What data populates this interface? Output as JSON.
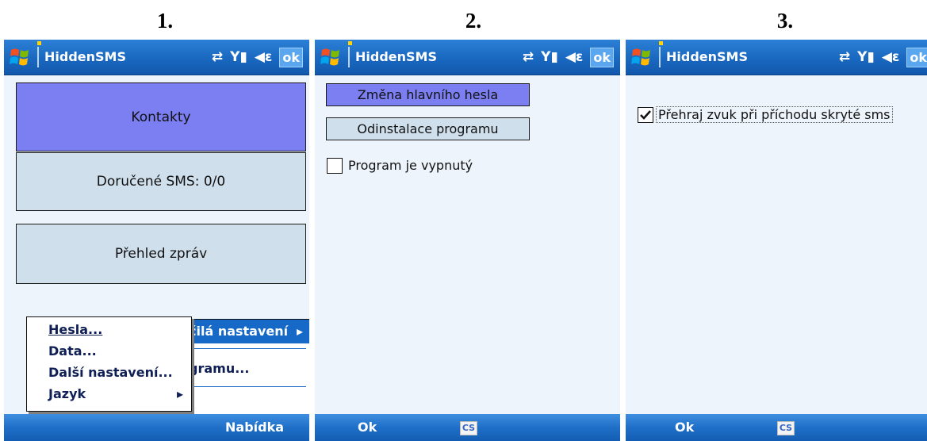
{
  "captions": [
    "1.",
    "2.",
    "3."
  ],
  "app": {
    "title": "HiddenSMS",
    "ok_label": "ok"
  },
  "screen1": {
    "buttons": [
      "Kontakty",
      "Doručené SMS: 0/0",
      "Přehled zpráv"
    ],
    "main_menu": {
      "item_advanced": "čilá nastavení",
      "item_program": "gramu..."
    },
    "submenu": [
      "Hesla...",
      "Data...",
      "Další nastavení...",
      "Jazyk"
    ],
    "softkey_right": "Nabídka"
  },
  "screen2": {
    "buttons": [
      "Změna hlavního hesla",
      "Odinstalace programu"
    ],
    "checkbox": {
      "label": "Program je vypnutý",
      "checked": false
    },
    "softkey_left": "Ok",
    "input_indicator": "CS"
  },
  "screen3": {
    "checkbox": {
      "label": "Přehraj zvuk při příchodu skryté sms",
      "checked": true
    },
    "softkey_left": "Ok",
    "input_indicator": "CS"
  },
  "colors": {
    "primary_button": "#7b7ff2",
    "secondary_button": "#cfdfec",
    "titlebar": "#1a68c0",
    "highlight": "#1669c6"
  }
}
